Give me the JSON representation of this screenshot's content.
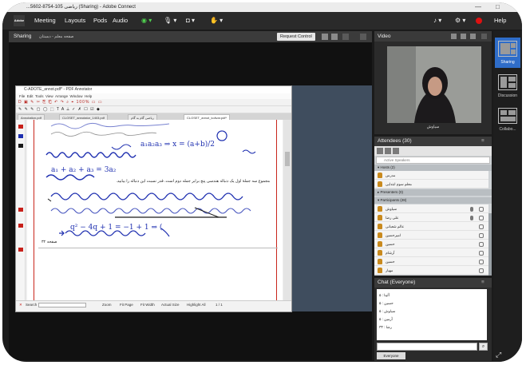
{
  "window": {
    "title": "...5602-8754-105 ریاضی (Sharing) - Adobe Connect",
    "controls": [
      "—",
      "□"
    ]
  },
  "menubar": {
    "logo": "Adobe",
    "items": [
      "Meeting",
      "Layouts",
      "Pods",
      "Audio"
    ],
    "help": "Help"
  },
  "share": {
    "title": "Sharing",
    "subtitle": "صفحه معلم - دبستان",
    "request_control": "Request Control"
  },
  "pdf": {
    "title": "C-ADOTE_annot.pdf* - PDF Annotator",
    "menu": [
      "File",
      "Edit",
      "Tools",
      "View",
      "Arrange",
      "Window",
      "Help"
    ],
    "toolbar_row1": "D ▣ ✎ ✂ ⎘ ⎗ ↶ ↷ ⌕ ⌖ 100% ▭ ▭",
    "toolbar_row2": "✎ ✎ ✎ ▢ ◯ ⬚ T A ⟂ ✓ ✗ ☐ ☑ ◆",
    "toolbar_row3": "Pen ✎ ▭ ▭ ◉",
    "tabs": [
      "Annotation.pdf",
      "CLOSET_annotator_1403.pdf",
      "ریاضی گام به گام",
      "CLOSET_annot_kolivar.pdf*"
    ],
    "active_tab": 3,
    "page_lines": [
      "a₁a₂a₃ ⇒ x = (a+b)/2",
      "a₁ + a₂ + a₃ = 3a₂",
      "مجموع سه جملهٔ اول یک دنباله هندسی پنج برابر جمله دوم است. قدر نسبت این دنباله را بیابید.",
      "q² − 4q + 1 = −1 + 1 ⇒ (",
      "۳۲ صفحه"
    ],
    "status": [
      "Search",
      "Zoom",
      "Fit Page",
      "Fit Width",
      "Actual Size",
      "Highlight All",
      "1 / 1"
    ]
  },
  "video": {
    "title": "Video",
    "participant_name": "سیاوش"
  },
  "attendees": {
    "title": "Attendees (30)",
    "search_placeholder": "Active Speakers",
    "groups": [
      {
        "label": "▾ Hosts (2)",
        "rows": [
          "مدرس",
          "معلم سوم ابتدایی"
        ]
      },
      {
        "label": "▸ Presenters (0)",
        "rows": []
      },
      {
        "label": "▾ Participants (28)",
        "rows": [
          "سیاوش",
          "علی رضا",
          "عالم شعبانی",
          "امیرحسین",
          "حسین",
          "آرشام",
          "حسین",
          "مهیار"
        ]
      }
    ]
  },
  "chat": {
    "title": "Chat (Everyone)",
    "messages": [
      "۵ : آلینا",
      "۵ : حسین",
      "۵ : سیاوش",
      "۵ : آرمین",
      "۳۳ : رضا"
    ],
    "tab": "Everyone",
    "send": "⌕"
  },
  "layouts": [
    {
      "label": "Sharing",
      "active": true
    },
    {
      "label": "Discussion",
      "active": false
    },
    {
      "label": "Collabo...",
      "active": false
    }
  ],
  "colors": {
    "ink_blue": "#1e2fb0",
    "ink_red": "#c8201a",
    "ink_black": "#1a1a1a",
    "accent": "#2f6dc9"
  }
}
